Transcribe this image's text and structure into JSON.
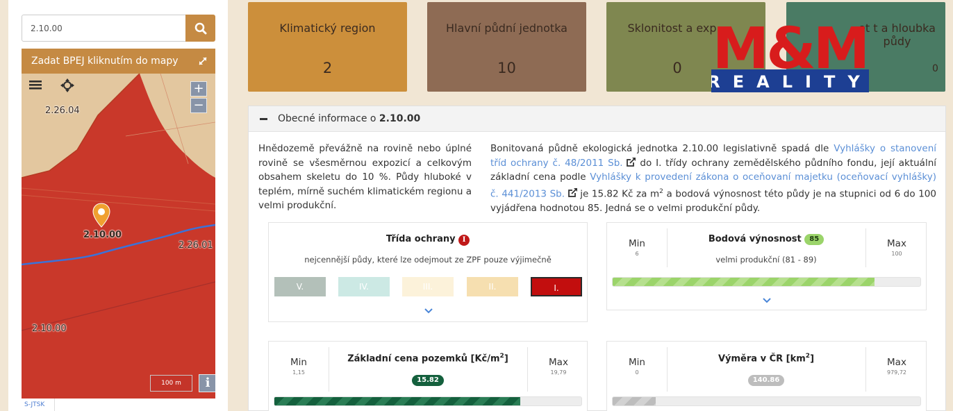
{
  "search": {
    "value": "2.10.00"
  },
  "map": {
    "header": "Zadat BPEJ kliknutím do mapy",
    "labels": [
      "2.26.04",
      "2.10.00",
      "2.26.01",
      "2.10.00"
    ],
    "zoom_in": "+",
    "zoom_out": "−",
    "scale": "100 m",
    "info": "i",
    "crs": "S-JTSK"
  },
  "tiles": [
    {
      "label": "Klimatický region",
      "value": "2"
    },
    {
      "label": "Hlavní půdní jednotka",
      "value": "10"
    },
    {
      "label": "Sklonitost a exp",
      "value": "0"
    },
    {
      "label": "et    t a hloubka půdy",
      "value": "0"
    }
  ],
  "logo": {
    "top": "M&M",
    "bottom": "REALITY"
  },
  "section": {
    "title_prefix": "Obecné informace o ",
    "title_code": "2.10.00",
    "left_text": "Hnědozemě převážně na rovině nebo úplné rovině se všesměrnou expozicí a celkovým obsahem skeletu do 10 %. Půdy hluboké v teplém, mírně suchém klimatickém regionu a velmi produkční.",
    "right": {
      "t1": "Bonitovaná půdně ekologická jednotka 2.10.00 legislativně spadá dle ",
      "l1": "Vyhlášky o stanovení tříd ochrany č. 48/2011 Sb.",
      "t2": " do I. třídy ochrany zemědělského půdního fondu, její aktuální základní cena podle ",
      "l2": "Vyhlášky k provedení zákona o oceňovaní majetku (oceňovací vyhlášky) č. 441/2013 Sb.",
      "t3": " je 15.82 Kč za m",
      "sup": "2",
      "t4": " a bodová výnosnost této půdy je na stupnici od 6 do 100 vyjádřena hodnotou 85. Jedná se o velmi produkční půdy."
    }
  },
  "trida": {
    "title": "Třída ochrany",
    "badge": "I",
    "subtitle": "nejcennější půdy, které lze odejmout ze ZPF pouze výjimečně",
    "classes": [
      {
        "label": "V.",
        "color": "#b3c0b9"
      },
      {
        "label": "IV.",
        "color": "#cce9e4"
      },
      {
        "label": "III.",
        "color": "#fcf2da"
      },
      {
        "label": "II.",
        "color": "#f6dfb0"
      },
      {
        "label": "I.",
        "color": "#c20e0e"
      }
    ],
    "active": "I."
  },
  "bodova": {
    "title": "Bodová výnosnost",
    "badge": "85",
    "subtitle": "velmi produkční (81 - 89)",
    "min_label": "Min",
    "min": "6",
    "max_label": "Max",
    "max": "100",
    "fill_fraction": 0.85
  },
  "cena": {
    "title": "Základní cena pozemků [Kč/m",
    "title_sup": "2",
    "title_end": "]",
    "badge": "15.82",
    "min_label": "Min",
    "min": "1,15",
    "max_label": "Max",
    "max": "19,79",
    "fill_fraction": 0.8
  },
  "vymera": {
    "title": "Výměra v ČR [km",
    "title_sup": "2",
    "title_end": "]",
    "badge": "140.86",
    "min_label": "Min",
    "min": "0",
    "max_label": "Max",
    "max": "979,72",
    "fill_fraction": 0.14
  },
  "colors": {
    "accent": "#c58a43",
    "badge_green": "#9bd46a",
    "badge_dark": "#14603d",
    "badge_gray": "#bdbdbd",
    "danger": "#c01818"
  }
}
